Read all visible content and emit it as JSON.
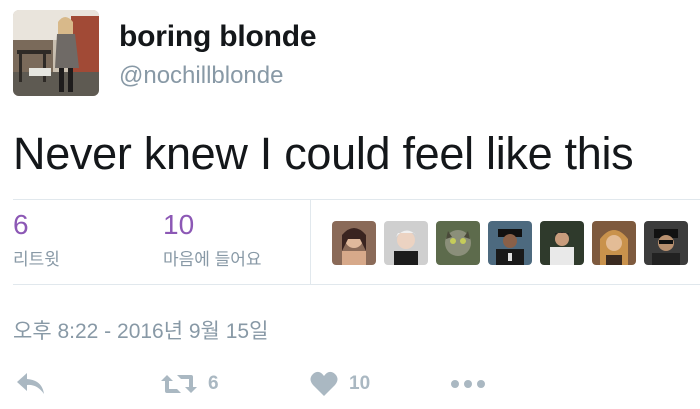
{
  "user": {
    "display_name": "boring blonde",
    "handle": "@nochillblonde"
  },
  "tweet": {
    "text": "Never knew I could feel like this",
    "timestamp": "오후 8:22 - 2016년 9월 15일"
  },
  "stats": {
    "retweets": {
      "count": "6",
      "label": "리트윗"
    },
    "likes": {
      "count": "10",
      "label": "마음에 들어요"
    },
    "liker_avatars": [
      "liker-avatar-1",
      "liker-avatar-2",
      "liker-avatar-3",
      "liker-avatar-4",
      "liker-avatar-5",
      "liker-avatar-6",
      "liker-avatar-7"
    ]
  },
  "actions": {
    "retweet_count": "6",
    "like_count": "10"
  },
  "icons": {
    "reply": "reply-icon",
    "retweet": "retweet-icon",
    "like": "heart-icon",
    "more": "more-icon"
  },
  "colors": {
    "stat_number": "#8c58b5",
    "muted": "#8899a6",
    "action_icon": "#aab8c2",
    "divider": "#e1e8ed"
  }
}
